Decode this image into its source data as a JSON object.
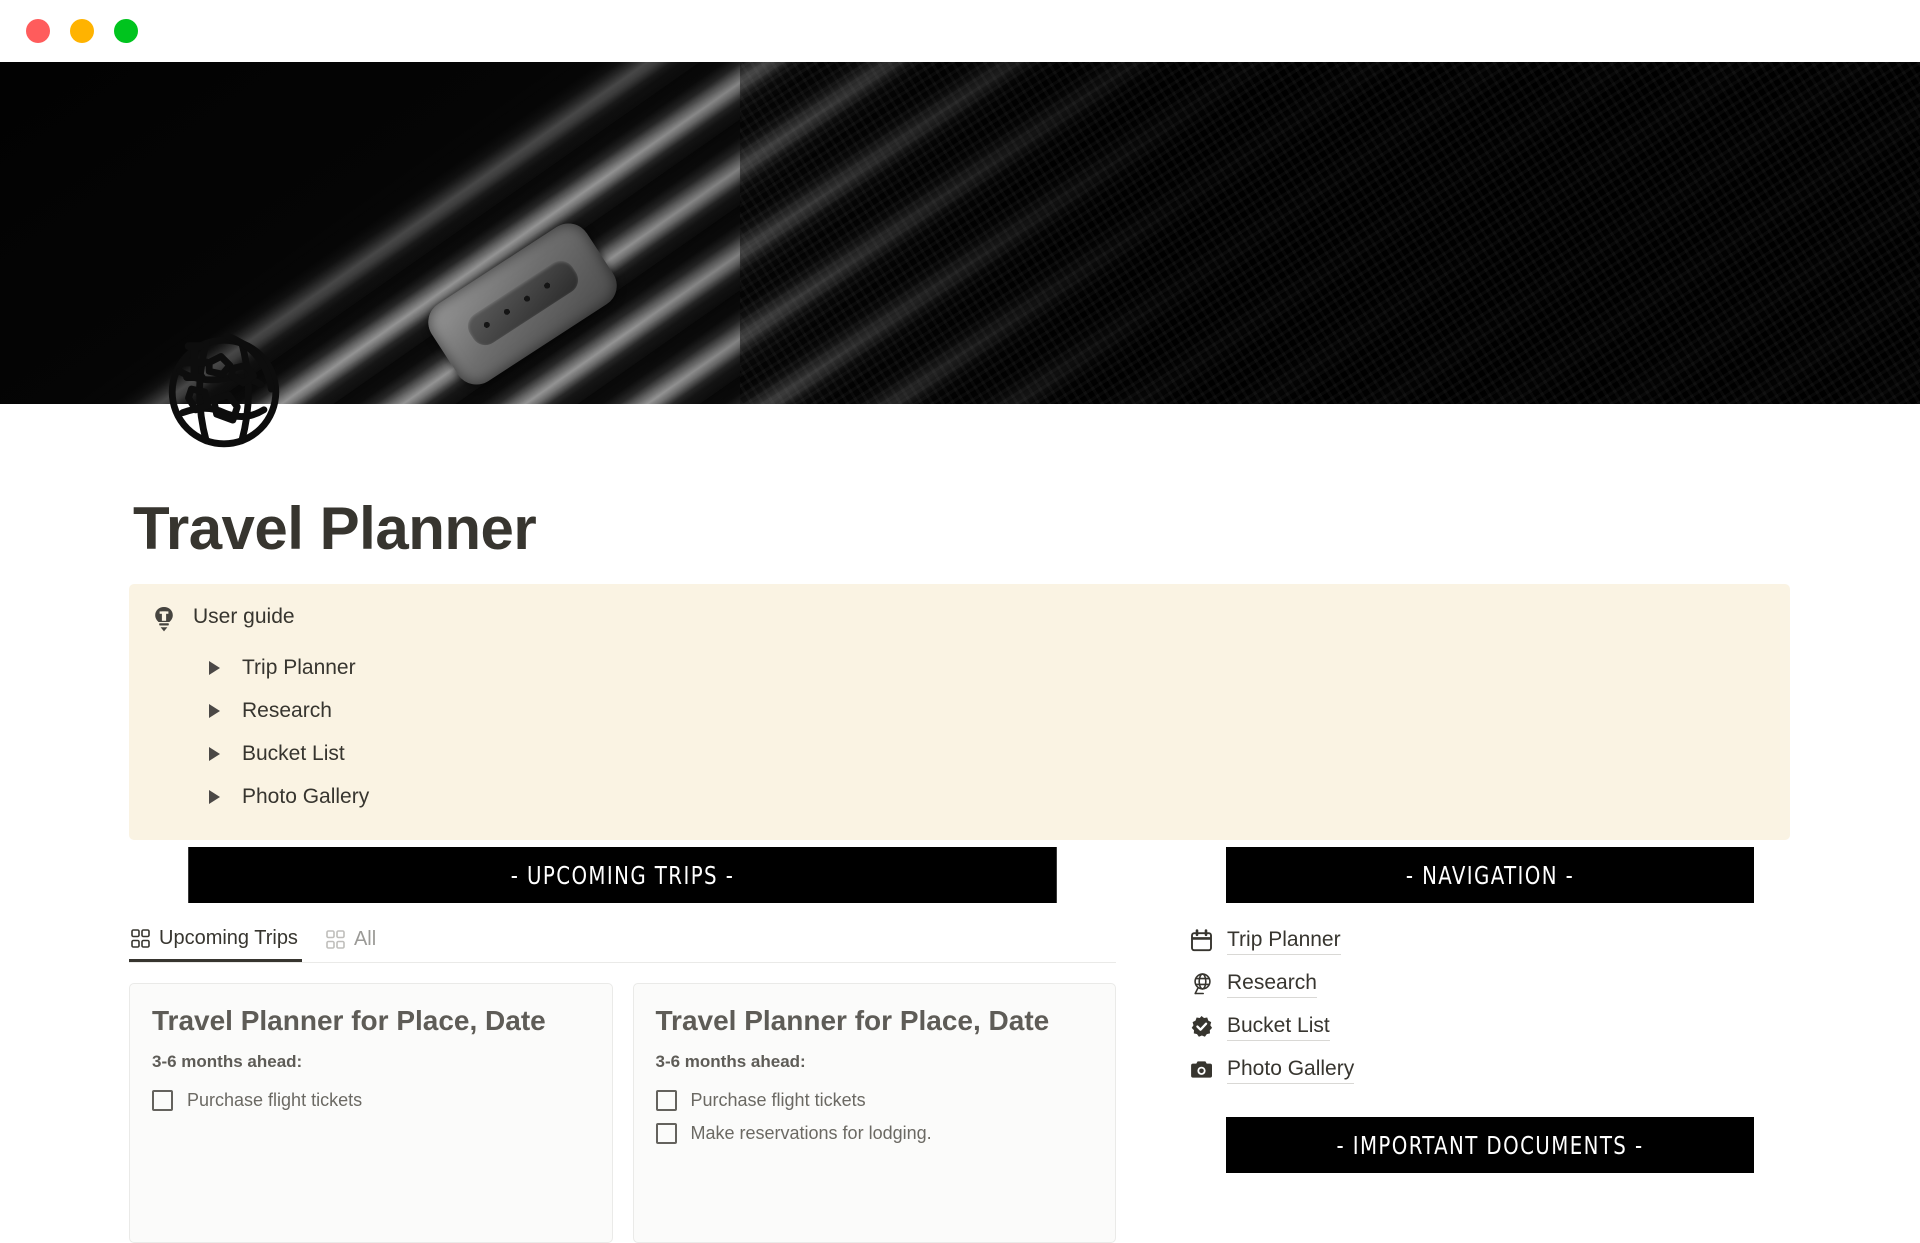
{
  "window": {
    "traffic_lights": [
      {
        "name": "close",
        "color": "#FF5C5C"
      },
      {
        "name": "minimize",
        "color": "#FFB300"
      },
      {
        "name": "maximize",
        "color": "#00C41E"
      }
    ]
  },
  "cover": {
    "icon_name": "globe-airplane-icon",
    "description": "aluminium suitcase close-up, black and white"
  },
  "page": {
    "title": "Travel Planner"
  },
  "callout": {
    "icon_name": "lightbulb-icon",
    "background": "#FAF3E3",
    "title": "User guide",
    "toggles": [
      {
        "label": "Trip Planner"
      },
      {
        "label": "Research"
      },
      {
        "label": "Bucket List"
      },
      {
        "label": "Photo Gallery"
      }
    ]
  },
  "upcoming_trips": {
    "band_label": "- UPCOMING TRIPS -",
    "tabs": [
      {
        "label": "Upcoming Trips",
        "icon_name": "gallery-view-icon",
        "active": true
      },
      {
        "label": "All",
        "icon_name": "gallery-view-icon",
        "active": false
      }
    ],
    "cards": [
      {
        "title": "Travel Planner for Place, Date",
        "subtitle": "3-6 months ahead:",
        "todos": [
          {
            "label": "Purchase flight tickets",
            "checked": false
          }
        ]
      },
      {
        "title": "Travel Planner for Place, Date",
        "subtitle": "3-6 months ahead:",
        "todos": [
          {
            "label": "Purchase flight tickets",
            "checked": false
          },
          {
            "label": "Make reservations for lodging.",
            "checked": false
          }
        ]
      }
    ]
  },
  "navigation": {
    "band_label": "- NAVIGATION -",
    "links": [
      {
        "label": "Trip Planner",
        "icon_name": "calendar-icon"
      },
      {
        "label": "Research",
        "icon_name": "globe-stand-icon"
      },
      {
        "label": "Bucket List",
        "icon_name": "verified-check-icon"
      },
      {
        "label": "Photo Gallery",
        "icon_name": "camera-icon"
      }
    ]
  },
  "important_documents": {
    "band_label": "- IMPORTANT DOCUMENTS -"
  },
  "colors": {
    "band_background": "#000000",
    "band_text": "#FFFFFF",
    "callout_background": "#FAF3E3",
    "card_background": "#FBFBFA",
    "text_primary": "#37352F",
    "text_muted": "#9B9A97"
  }
}
